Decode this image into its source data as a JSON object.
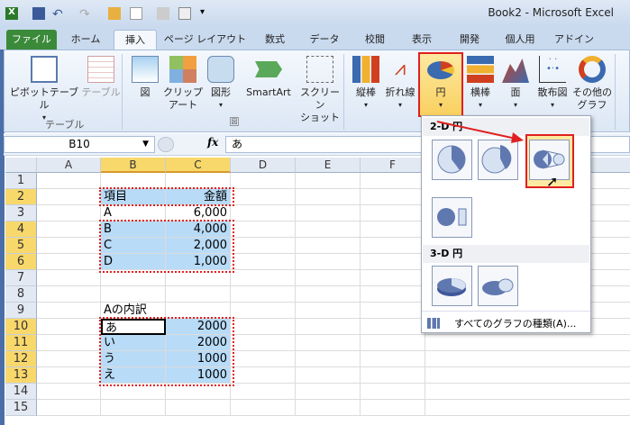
{
  "title": "Book2 - Microsoft Excel",
  "tabs": [
    "ファイル",
    "ホーム",
    "挿入",
    "ページ レイアウト",
    "数式",
    "データ",
    "校閲",
    "表示",
    "開発",
    "個人用",
    "アドイン"
  ],
  "ribbon": {
    "pivot": "ピボットテーブル",
    "table": "テーブル",
    "group_table": "テーブル",
    "picture": "図",
    "clipart1": "クリップ",
    "clipart2": "アート",
    "shapes": "図形",
    "smartart": "SmartArt",
    "screenshot1": "スクリーン",
    "screenshot2": "ショット",
    "column": "縦棒",
    "line": "折れ線",
    "pie": "円",
    "bar": "横棒",
    "area": "面",
    "scatter": "散布図",
    "other1": "その他の",
    "other2": "グラフ"
  },
  "namebox": "B10",
  "formula": "あ",
  "columns": [
    "A",
    "B",
    "C",
    "D",
    "E",
    "F"
  ],
  "rows": [
    "1",
    "2",
    "3",
    "4",
    "5",
    "6",
    "7",
    "8",
    "9",
    "10",
    "11",
    "12",
    "13",
    "14",
    "15"
  ],
  "cells": {
    "b2": "項目",
    "c2": "金額",
    "b3": "A",
    "c3": "6,000",
    "b4": "B",
    "c4": "4,000",
    "b5": "C",
    "c5": "2,000",
    "b6": "D",
    "c6": "1,000",
    "b9": "Aの内訳",
    "b10": "あ",
    "c10": "2000",
    "b11": "い",
    "c11": "2000",
    "b12": "う",
    "c12": "1000",
    "b13": "え",
    "c13": "1000"
  },
  "menu": {
    "h2d": "2-D 円",
    "h3d": "3-D 円",
    "all": "すべてのグラフの種類(A)..."
  },
  "colors": {
    "accent": "#e02020",
    "selected_header": "#f9d86b",
    "highlight": "#b8dbf7"
  }
}
